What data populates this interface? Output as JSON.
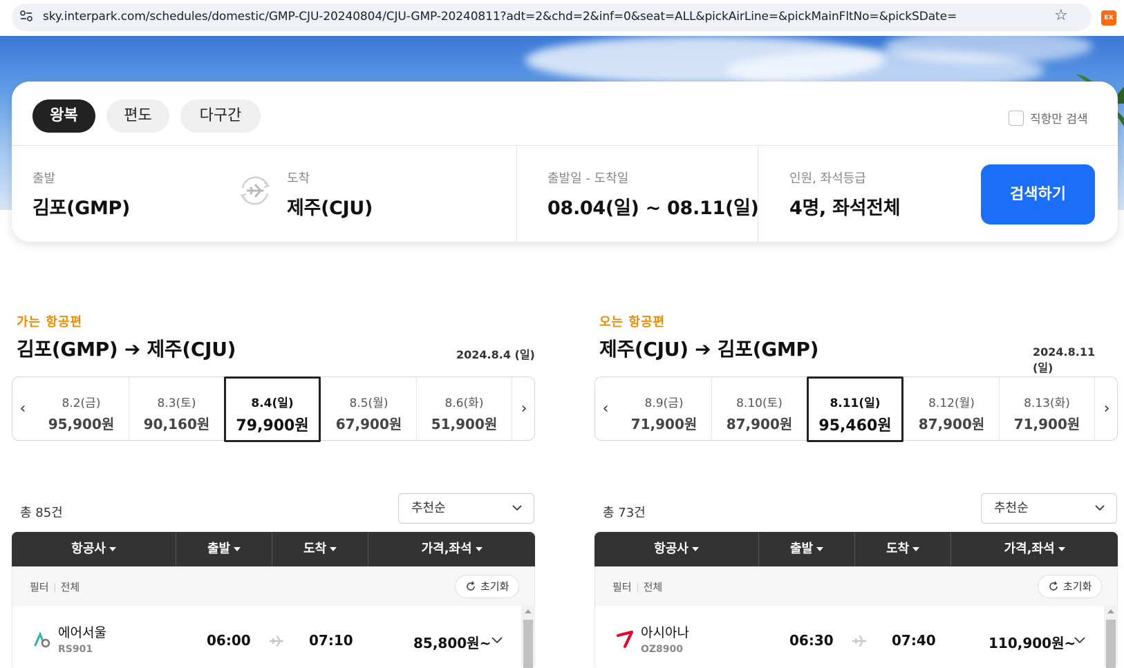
{
  "browser": {
    "url": "sky.interpark.com/schedules/domestic/GMP-CJU-20240804/CJU-GMP-20240811?adt=2&chd=2&inf=0&seat=ALL&pickAirLine=&pickMainFltNo=&pickSDate=",
    "ext_label": "EX"
  },
  "search": {
    "tabs": [
      {
        "label": "왕복",
        "active": true
      },
      {
        "label": "편도",
        "active": false
      },
      {
        "label": "다구간",
        "active": false
      }
    ],
    "direct_only_label": "직항만 검색",
    "departure_label": "출발",
    "departure_value": "김포(GMP)",
    "arrival_label": "도착",
    "arrival_value": "제주(CJU)",
    "dates_label": "출발일 - 도착일",
    "dates_value": "08.04(일) ~ 08.11(일)",
    "passengers_label": "인원, 좌석등급",
    "passengers_value": "4명, 좌석전체",
    "search_button": "검색하기"
  },
  "outbound": {
    "section_label": "가는 항공편",
    "route": "김포(GMP) ➔ 제주(CJU)",
    "date": "2024.8.4 (일)",
    "dates": [
      {
        "day": "8.2(금)",
        "price": "95,900원"
      },
      {
        "day": "8.3(토)",
        "price": "90,160원"
      },
      {
        "day": "8.4(일)",
        "price": "79,900원"
      },
      {
        "day": "8.5(월)",
        "price": "67,900원"
      },
      {
        "day": "8.6(화)",
        "price": "51,900원"
      }
    ],
    "total": "총 85건",
    "sort": "추천순",
    "headers": [
      "항공사",
      "출발",
      "도착",
      "가격,좌석"
    ],
    "filter_label": "필터",
    "filter_value": "전체",
    "reset": "초기화",
    "flight": {
      "airline": "에어서울",
      "flight_no": "RS901",
      "depart": "06:00",
      "arrive": "07:10",
      "price": "85,800원~"
    }
  },
  "inbound": {
    "section_label": "오는 항공편",
    "route": "제주(CJU) ➔ 김포(GMP)",
    "date": "2024.8.11 (일)",
    "dates": [
      {
        "day": "8.9(금)",
        "price": "71,900원"
      },
      {
        "day": "8.10(토)",
        "price": "87,900원"
      },
      {
        "day": "8.11(일)",
        "price": "95,460원"
      },
      {
        "day": "8.12(월)",
        "price": "87,900원"
      },
      {
        "day": "8.13(화)",
        "price": "71,900원"
      }
    ],
    "total": "총 73건",
    "sort": "추천순",
    "headers": [
      "항공사",
      "출발",
      "도착",
      "가격,좌석"
    ],
    "filter_label": "필터",
    "filter_value": "전체",
    "reset": "초기화",
    "flight": {
      "airline": "아시아나",
      "flight_no": "OZ8900",
      "depart": "06:30",
      "arrive": "07:40",
      "price": "110,900원~"
    }
  },
  "colors": {
    "accent_blue": "#1a6ef7",
    "section_orange": "#f08c00",
    "header_dark": "#333333"
  }
}
